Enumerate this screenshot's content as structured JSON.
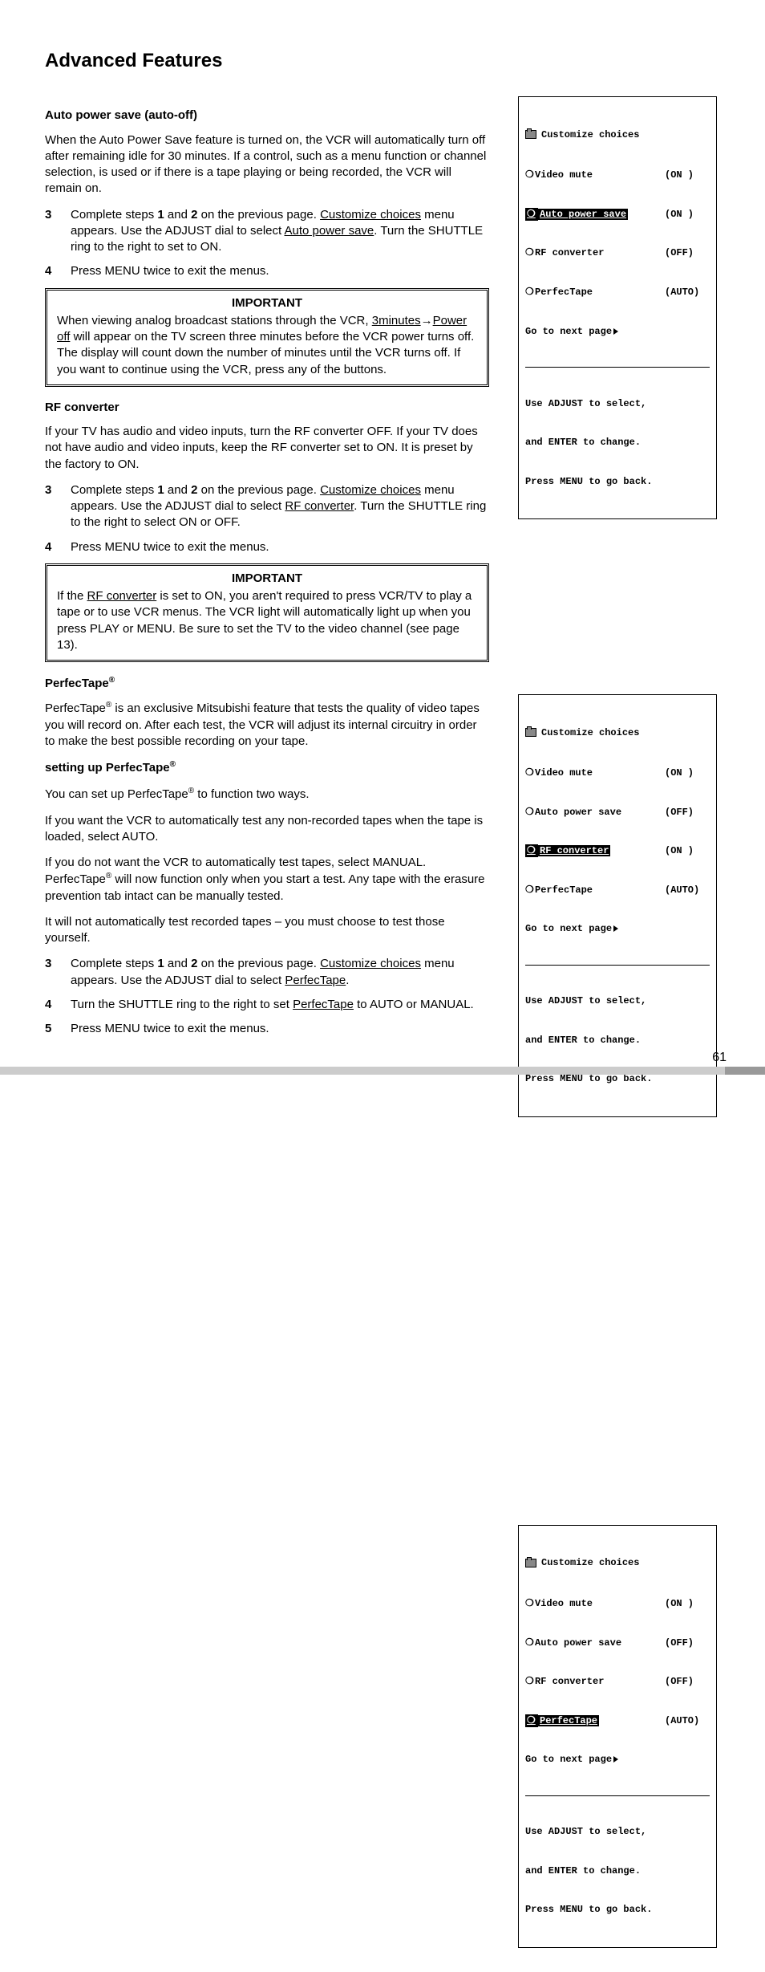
{
  "title": "Advanced Features",
  "page_number": "61",
  "sec1": {
    "heading": "Auto power save (auto-off)",
    "intro": "When the Auto Power Save feature is turned on, the VCR will automatically turn off after remaining idle for 30 minutes.  If a control, such as a menu function or channel selection, is used or if there is a tape playing or being recorded, the VCR will remain on.",
    "step3_a": "Complete steps ",
    "step3_b12": "1",
    "step3_and": " and ",
    "step3_b2": "2",
    "step3_c": " on the previous page.  ",
    "step3_u1": "Customize choices",
    "step3_d": " menu appears.  Use the ADJUST dial to select ",
    "step3_u2": "Auto power save",
    "step3_e": ".  Turn the SHUTTLE ring to the right to set to ON.",
    "step4": "Press MENU twice to exit the menus.",
    "important_title": "IMPORTANT",
    "imp_a": "When viewing analog broadcast stations through the VCR, ",
    "imp_u1": "3minutes",
    "imp_arrow": "→",
    "imp_u2": "Power off",
    "imp_b": " will appear on the TV screen three minutes before the VCR power turns off.  The display will count down the number of minutes until the VCR turns off.  If you want to continue using the VCR, press any of the buttons."
  },
  "sec2": {
    "heading": "RF converter",
    "intro": "If your TV has audio and video inputs, turn the RF converter OFF.  If your TV does not have audio and video inputs, keep the RF converter set to ON.  It is preset by the factory to ON.",
    "step3_a": "Complete steps ",
    "step3_c": " on the previous page.  ",
    "step3_u1": "Customize choices",
    "step3_d": " menu appears.  Use the ADJUST dial to select ",
    "step3_u2": "RF converter",
    "step3_e": ".  Turn the SHUTTLE ring to the right to select ON or OFF.",
    "step4": "Press MENU twice to exit the menus.",
    "important_title": "IMPORTANT",
    "imp_a": "If the ",
    "imp_u": "RF converter",
    "imp_b": " is set to ON, you aren't required to press VCR/TV to play a tape or to use VCR menus.  The VCR light will automatically light up when you press PLAY or MENU.  Be sure to set the TV to the video channel (see page 13)."
  },
  "sec3": {
    "heading": "PerfecTape",
    "reg": "®",
    "intro_a": "PerfecTape",
    "intro_b": " is an exclusive Mitsubishi feature that tests the quality of video tapes you will record on.  After each test, the VCR will adjust its internal circuitry in order to make the best possible recording on your tape.",
    "sub2_a": "setting up PerfecTape",
    "p2_a": "You can set up PerfecTape",
    "p2_b": " to function two ways.",
    "p3": "If you want the VCR to automatically test any non-recorded tapes when the tape is loaded, select AUTO.",
    "p4_a": "If you do not want the VCR to automatically test tapes, select MANUAL.  PerfecTape",
    "p4_b": " will now function only when you start a test.  Any tape with the erasure prevention tab intact can be manually tested.",
    "p5": "It will not automatically test recorded tapes – you must choose to test those yourself.",
    "step3_a": "Complete steps ",
    "step3_c": " on the previous page.  ",
    "step3_u1": "Customize choices",
    "step3_d": " menu appears.  Use the ADJUST dial to select ",
    "step3_u2": "PerfecTape",
    "step3_e": ".",
    "step4_a": "Turn the SHUTTLE ring to the right to set ",
    "step4_u": "PerfecTape",
    "step4_b": " to AUTO or MANUAL.",
    "step5": "Press MENU twice to exit the menus."
  },
  "osd_common": {
    "title": "Customize choices",
    "video_mute": "Video mute",
    "auto_power": "Auto power save",
    "rf_conv": "RF converter",
    "perfectape": "PerfecTape",
    "next_page": "Go to next page",
    "help1": "Use ADJUST to select,",
    "help2": "and ENTER to change.",
    "help3": "Press MENU to go back."
  },
  "osd1": {
    "vm": "(ON )",
    "ap": "(ON )",
    "rf": "(OFF)",
    "pt": "(AUTO)"
  },
  "osd2": {
    "vm": "(ON )",
    "ap": "(OFF)",
    "rf": "(ON )",
    "pt": "(AUTO)"
  },
  "osd3": {
    "vm": "(ON )",
    "ap": "(OFF)",
    "rf": "(OFF)",
    "pt": "(AUTO)"
  }
}
